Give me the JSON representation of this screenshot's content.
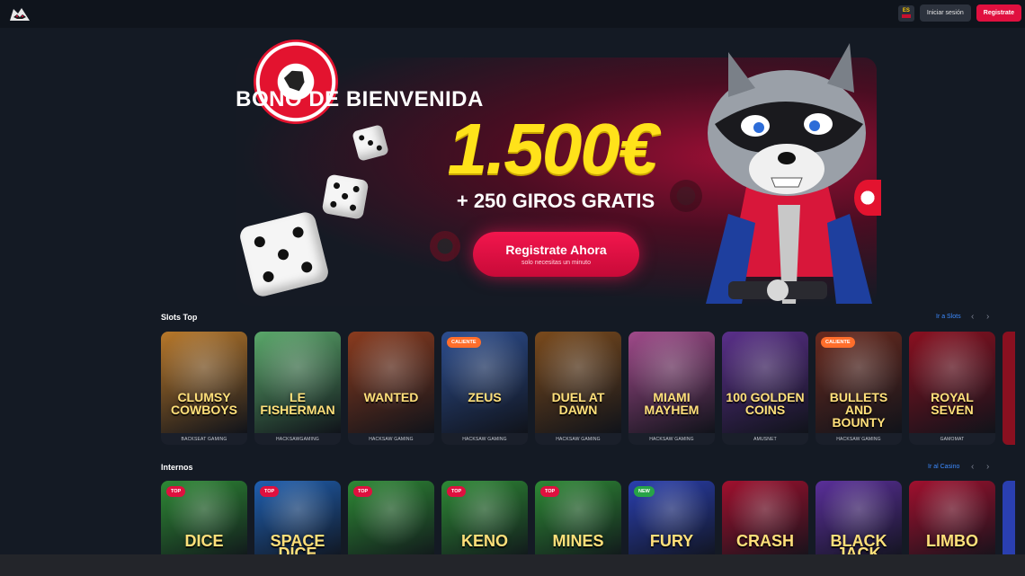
{
  "header": {
    "logo": "raccoon-logo",
    "language": "ES",
    "login_label": "Iniciar sesión",
    "register_label": "Registrate"
  },
  "hero": {
    "title": "BONO DE BIENVENIDA",
    "amount": "1.500€",
    "spins": "+ 250 GIROS GRATIS",
    "cta_label": "Registrate Ahora",
    "cta_sub": "solo necesitas un minuto",
    "colors": {
      "accent": "#e0103f",
      "amount": "#ffe21a"
    }
  },
  "slots_section": {
    "title": "Slots Top",
    "link": "Ir a Slots",
    "games": [
      {
        "name": "CLUMSY COWBOYS",
        "provider": "BACKSEAT GAMING",
        "badge": "",
        "color": "#b8782a"
      },
      {
        "name": "LE FISHERMAN",
        "provider": "HACKSAWGAMING",
        "badge": "",
        "color": "#5aa86a"
      },
      {
        "name": "WANTED",
        "provider": "HACKSAW GAMING",
        "badge": "",
        "color": "#8a3b1e"
      },
      {
        "name": "ZEUS",
        "provider": "HACKSAW GAMING",
        "badge": "CALIENTE",
        "color": "#2c4d8f"
      },
      {
        "name": "DUEL AT DAWN",
        "provider": "HACKSAW GAMING",
        "badge": "",
        "color": "#7a4a1c"
      },
      {
        "name": "MIAMI MAYHEM",
        "provider": "HACKSAW GAMING",
        "badge": "",
        "color": "#a04a8a"
      },
      {
        "name": "100 GOLDEN COINS",
        "provider": "AMUSNET",
        "badge": "",
        "color": "#5a2f8a"
      },
      {
        "name": "BULLETS AND BOUNTY",
        "provider": "HACKSAW GAMING",
        "badge": "CALIENTE",
        "color": "#6a2a1e"
      },
      {
        "name": "ROYAL SEVEN",
        "provider": "GAMOMAT",
        "badge": "",
        "color": "#8a1020"
      }
    ]
  },
  "internal_section": {
    "title": "Internos",
    "link": "Ir al Casino",
    "games": [
      {
        "name": "DICE",
        "badge": "TOP",
        "color": "#2e8a35"
      },
      {
        "name": "SPACE DICE",
        "badge": "TOP",
        "color": "#1f5fb0"
      },
      {
        "name": "",
        "badge": "TOP",
        "color": "#2e8a35"
      },
      {
        "name": "KENO",
        "badge": "TOP",
        "color": "#2e8a35"
      },
      {
        "name": "MINES",
        "badge": "TOP",
        "color": "#2e8a35"
      },
      {
        "name": "FURY",
        "badge": "NEW",
        "color": "#2a3fb0"
      },
      {
        "name": "CRASH",
        "badge": "",
        "color": "#a0102e"
      },
      {
        "name": "BLACK JACK",
        "badge": "",
        "color": "#5a2f9a"
      },
      {
        "name": "LIMBO",
        "badge": "",
        "color": "#a0102e"
      }
    ]
  }
}
